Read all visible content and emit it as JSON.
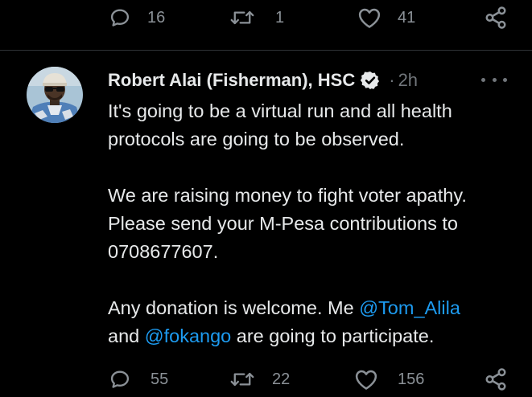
{
  "top_actions": {
    "reply_count": "16",
    "retweet_count": "1",
    "like_count": "41"
  },
  "tweet": {
    "author_name": "Robert Alai (Fisherman), HSC",
    "separator": "·",
    "time": "2h",
    "paragraphs": {
      "p1": "It's going to be a virtual run and all health protocols are going to be observed.",
      "p2": "We are raising money to fight voter apathy. Please send your M-Pesa contributions to 0708677607.",
      "p3_before": "Any donation is welcome. Me ",
      "mention1": "@Tom_Alila",
      "p3_middle": " and ",
      "mention2": "@fokango",
      "p3_after": " are going to participate."
    },
    "actions": {
      "reply_count": "55",
      "retweet_count": "22",
      "like_count": "156"
    }
  },
  "colors": {
    "background": "#000000",
    "text": "#e7e9ea",
    "secondary": "#71767b",
    "accent": "#1d9bf0",
    "divider": "#2f3336"
  },
  "icons": {
    "reply": "speech-bubble-icon",
    "retweet": "retweet-arrows-icon",
    "like": "heart-icon",
    "share": "share-icon",
    "verified": "verified-badge-icon",
    "more": "more-dots-icon"
  }
}
